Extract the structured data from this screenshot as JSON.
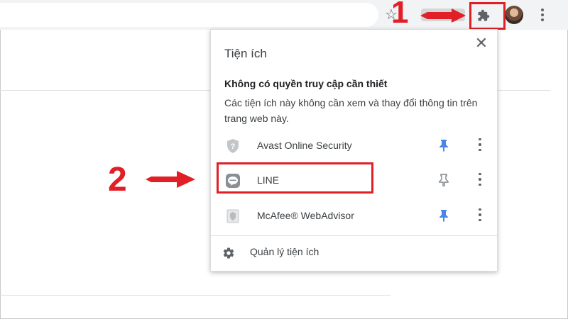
{
  "toolbar": {
    "bookmark_icon": "star-icon",
    "extensions_icon": "puzzle-icon",
    "menu_icon": "three-dot-menu-icon"
  },
  "popup": {
    "title": "Tiện ích",
    "close_icon": "close-icon",
    "section_heading": "Không có quyền truy cập cần thiết",
    "section_description": "Các tiện ích này không cần xem và thay đổi thông tin trên trang web này.",
    "extensions": [
      {
        "name": "Avast Online Security",
        "icon": "shield-icon",
        "pinned": true
      },
      {
        "name": "LINE",
        "icon": "line-chat-icon",
        "pinned": false
      },
      {
        "name": "McAfee® WebAdvisor",
        "icon": "mcafee-icon",
        "pinned": true
      }
    ],
    "manage_label": "Quản lý tiện ích"
  },
  "annotations": {
    "step1": "1",
    "step2": "2",
    "color": "#e01f26"
  },
  "colors": {
    "pin_active": "#4a86e8",
    "pin_inactive": "#80868b",
    "icon_gray": "#5f6368"
  }
}
